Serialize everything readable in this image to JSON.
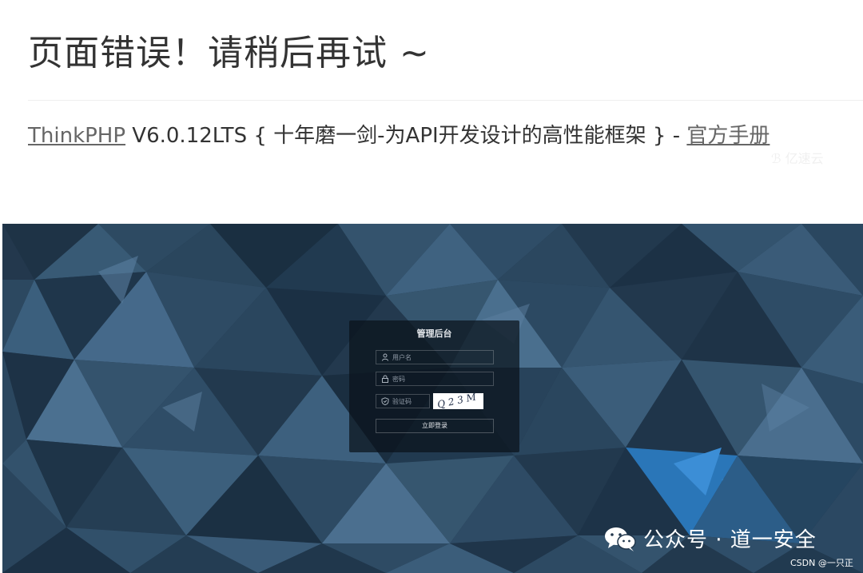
{
  "error_page": {
    "title": "页面错误！请稍后再试 ~",
    "framework_name": "ThinkPHP",
    "framework_version": "V6.0.12LTS",
    "framework_slogan": "{ 十年磨一剑-为API开发设计的高性能框架 } -",
    "manual_link": "官方手册",
    "faded_mark": "ℬ 亿速云"
  },
  "login": {
    "title": "管理后台",
    "username_placeholder": "用户名",
    "password_placeholder": "密码",
    "captcha_placeholder": "验证码",
    "captcha_code": "Q23M",
    "submit_label": "立即登录"
  },
  "watermark": {
    "text": "公众号 · 道一安全",
    "csdn": "CSDN @一只正"
  },
  "colors": {
    "background_dark": "#23384d",
    "accent_blue": "#3c8ed6",
    "panel": "#0a121a"
  },
  "icons": [
    "user-icon",
    "lock-icon",
    "shield-icon",
    "wechat-icon"
  ]
}
